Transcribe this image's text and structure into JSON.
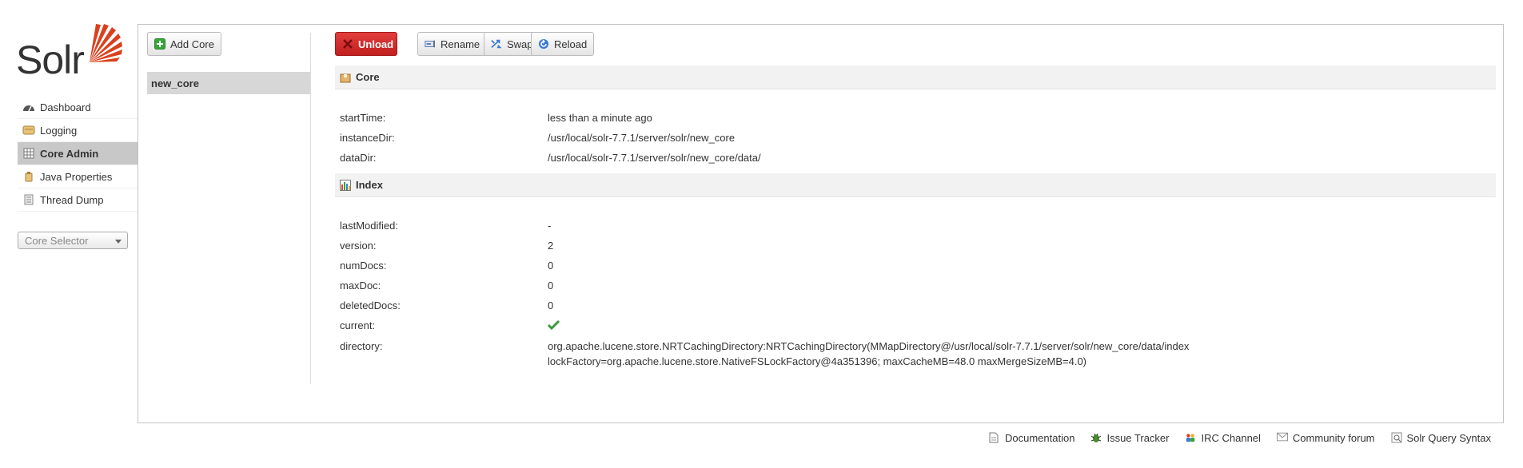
{
  "logo": {
    "text": "Solr"
  },
  "nav": {
    "items": [
      {
        "label": "Dashboard",
        "icon": "dashboard-icon",
        "active": false
      },
      {
        "label": "Logging",
        "icon": "logging-icon",
        "active": false
      },
      {
        "label": "Core Admin",
        "icon": "core-admin-icon",
        "active": true
      },
      {
        "label": "Java Properties",
        "icon": "java-properties-icon",
        "active": false
      },
      {
        "label": "Thread Dump",
        "icon": "thread-dump-icon",
        "active": false
      }
    ],
    "core_selector": {
      "placeholder": "Core Selector"
    }
  },
  "core_list": {
    "add_button": "Add Core",
    "cores": [
      "new_core"
    ]
  },
  "toolbar": {
    "unload": "Unload",
    "rename": "Rename",
    "swap": "Swap",
    "reload": "Reload"
  },
  "core_section": {
    "title": "Core",
    "rows": [
      {
        "key": "startTime:",
        "value": "less than a minute ago"
      },
      {
        "key": "instanceDir:",
        "value": "/usr/local/solr-7.7.1/server/solr/new_core"
      },
      {
        "key": "dataDir:",
        "value": "/usr/local/solr-7.7.1/server/solr/new_core/data/"
      }
    ]
  },
  "index_section": {
    "title": "Index",
    "rows": [
      {
        "key": "lastModified:",
        "value": "-"
      },
      {
        "key": "version:",
        "value": "2"
      },
      {
        "key": "numDocs:",
        "value": "0"
      },
      {
        "key": "maxDoc:",
        "value": "0"
      },
      {
        "key": "deletedDocs:",
        "value": "0"
      },
      {
        "key": "current:",
        "value": ""
      },
      {
        "key": "directory:",
        "value": "org.apache.lucene.store.NRTCachingDirectory:NRTCachingDirectory(MMapDirectory@/usr/local/solr-7.7.1/server/solr/new_core/data/index",
        "value2": "lockFactory=org.apache.lucene.store.NativeFSLockFactory@4a351396; maxCacheMB=48.0 maxMergeSizeMB=4.0)"
      }
    ]
  },
  "footer": {
    "links": [
      {
        "label": "Documentation",
        "icon": "documentation-icon"
      },
      {
        "label": "Issue Tracker",
        "icon": "bug-icon"
      },
      {
        "label": "IRC Channel",
        "icon": "irc-icon"
      },
      {
        "label": "Community forum",
        "icon": "mail-icon"
      },
      {
        "label": "Solr Query Syntax",
        "icon": "query-syntax-icon"
      }
    ]
  },
  "colors": {
    "unload": "#c21f1f",
    "active_nav": "#c8c8c8",
    "accent": "#d9411e",
    "check": "#3a9a3a"
  }
}
